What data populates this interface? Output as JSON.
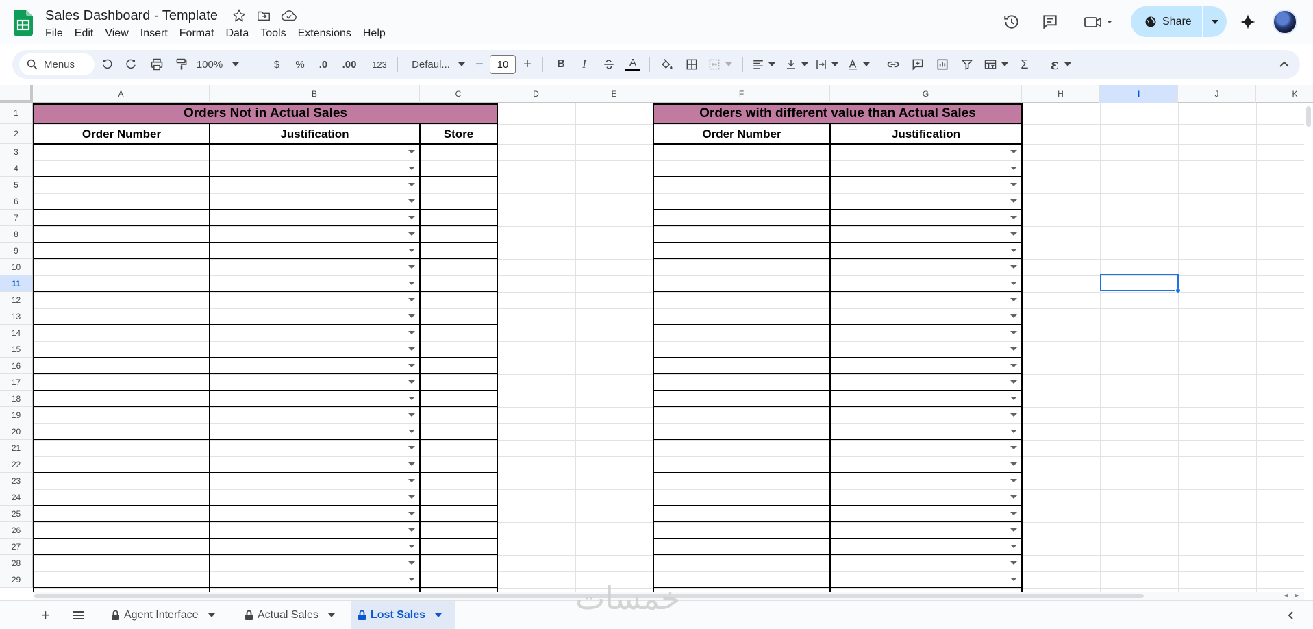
{
  "document": {
    "title": "Sales Dashboard - Template",
    "menus": [
      "File",
      "Edit",
      "View",
      "Insert",
      "Format",
      "Data",
      "Tools",
      "Extensions",
      "Help"
    ]
  },
  "header_actions": {
    "share_label": "Share"
  },
  "toolbar": {
    "menus_label": "Menus",
    "zoom": "100%",
    "currency": "$",
    "percent": "%",
    "decrease_decimals": ".0",
    "increase_decimals": ".00",
    "number_format": "123",
    "font_family": "Defaul...",
    "font_size": "10",
    "bold": "B",
    "italic": "I",
    "text_color_label": "A"
  },
  "columns": [
    "A",
    "B",
    "C",
    "D",
    "E",
    "F",
    "G",
    "H",
    "I",
    "J",
    "K"
  ],
  "selected_column": "I",
  "rows": [
    "1",
    "2",
    "3",
    "4",
    "5",
    "6",
    "7",
    "8",
    "9",
    "10",
    "11",
    "12",
    "13",
    "14",
    "15",
    "16",
    "17",
    "18",
    "19",
    "20",
    "21",
    "22",
    "23",
    "24",
    "25",
    "26",
    "27",
    "28",
    "29"
  ],
  "selected_row": "11",
  "left_table": {
    "title": "Orders Not in Actual Sales",
    "headers": [
      "Order Number",
      "Justification",
      "Store"
    ]
  },
  "right_table": {
    "title": "Orders with different value than Actual Sales",
    "headers": [
      "Order Number",
      "Justification"
    ]
  },
  "sheets": [
    {
      "name": "Agent Interface",
      "locked": true,
      "active": false
    },
    {
      "name": "Actual Sales",
      "locked": true,
      "active": false
    },
    {
      "name": "Lost Sales",
      "locked": true,
      "active": true
    }
  ],
  "watermark": "خمسات",
  "colors": {
    "banner": "#c27ba0",
    "accent": "#0b57d0",
    "selection": "#1a73e8"
  }
}
